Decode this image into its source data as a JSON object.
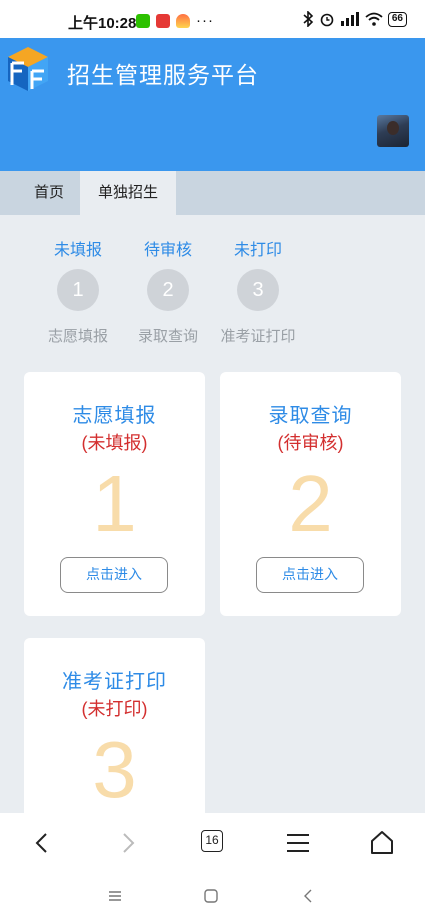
{
  "status_bar": {
    "time": "上午10:28",
    "dots": "···",
    "battery": "66"
  },
  "header": {
    "title": "招生管理服务平台"
  },
  "tabs": [
    {
      "label": "首页"
    },
    {
      "label": "单独招生"
    }
  ],
  "steps": [
    {
      "status": "未填报",
      "number": "1",
      "label": "志愿填报"
    },
    {
      "status": "待审核",
      "number": "2",
      "label": "录取查询"
    },
    {
      "status": "未打印",
      "number": "3",
      "label": "准考证打印"
    }
  ],
  "cards": [
    {
      "title": "志愿填报",
      "status": "(未填报)",
      "number": "1",
      "button": "点击进入"
    },
    {
      "title": "录取查询",
      "status": "(待审核)",
      "number": "2",
      "button": "点击进入"
    },
    {
      "title": "准考证打印",
      "status": "(未打印)",
      "number": "3"
    }
  ],
  "browser": {
    "tab_count": "16"
  },
  "colors": {
    "header_bg": "#3a97ee",
    "accent_blue": "#2e8be6",
    "status_red": "#d32f2f",
    "number_peach": "#f8dcaa"
  },
  "icons": [
    "wechat-icon",
    "notification-icon",
    "app-icon",
    "bluetooth-icon",
    "alarm-icon",
    "signal-icon",
    "wifi-icon",
    "battery-icon",
    "back-icon",
    "forward-icon",
    "tabs-icon",
    "menu-icon",
    "home-icon"
  ]
}
